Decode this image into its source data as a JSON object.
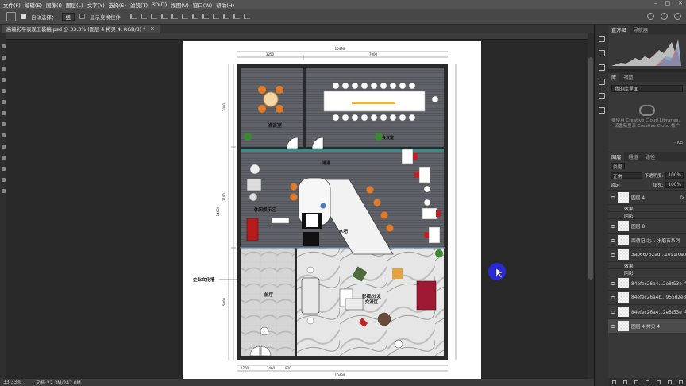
{
  "menubar": {
    "items": [
      "文件(F)",
      "编辑(E)",
      "图像(I)",
      "图层(L)",
      "文字(Y)",
      "选择(S)",
      "滤镜(T)",
      "3D(D)",
      "视图(V)",
      "窗口(W)",
      "帮助(H)"
    ]
  },
  "options": {
    "auto_select_label": "自动选择：",
    "auto_select_value": "组",
    "show_transform_label": "显示变换控件"
  },
  "document": {
    "tab_title": "高端彩平表现工装稿.psd @ 33.3% (图层 4 拷贝 4, RGB/8) *",
    "close_glyph": "×"
  },
  "status": {
    "zoom": "33.33%",
    "doc_size": "文档:22.3M/247.0M"
  },
  "plan": {
    "rooms": {
      "negotiation": "洽谈室",
      "meeting": "会议室",
      "corridor": "通道",
      "leisure": "休闲娱乐区",
      "bar": "水吧",
      "lobby": "前厅",
      "av_sofa_1": "影视/沙发",
      "av_sofa_2": "交流区",
      "culture_wall": "企业文化墙"
    },
    "dims_top": [
      "3250",
      "7000"
    ],
    "dims_top_total": "10490",
    "dims_left": [
      "2000",
      "3190",
      "5000"
    ],
    "dims_left_total": "14600",
    "dims_bottom": [
      "1460",
      "820"
    ],
    "dims_bottom_total": "10490",
    "dims_bottom_small": "1700"
  },
  "panels": {
    "tabs_top": [
      "直方图",
      "导航器"
    ],
    "tabs_mid": [
      "库",
      "调整"
    ],
    "library_select": "我的库里面",
    "cc_message": "要使用 Creative Cloud Libraries，请重新登录 Creative Cloud 帐户",
    "kb_label": "- KB",
    "tabs_layers": [
      "图层",
      "通道",
      "路径"
    ],
    "kind_filter": "类型",
    "blend_mode": "正常",
    "opacity_label": "不透明度:",
    "opacity_value": "100%",
    "lock_label": "锁定:",
    "fill_label": "填充:",
    "fill_value": "100%",
    "layers": [
      {
        "name": "图层 4",
        "fx": "fx",
        "selected": false
      },
      {
        "name": "效果",
        "sub": true
      },
      {
        "name": "阴影",
        "sub": true
      },
      {
        "name": "图层 8",
        "selected": false
      },
      {
        "name": "西德记 北... 水磨石系列",
        "selected": false
      },
      {
        "name": "3ab66732ad...1091fce0d",
        "fx": "fx",
        "selected": false
      },
      {
        "name": "效果",
        "sub": true
      },
      {
        "name": "阴影",
        "sub": true
      },
      {
        "name": "84efec26a4...2e8f53e 拷贝",
        "selected": false
      },
      {
        "name": "84efec26a4b...955d2e8f53e",
        "selected": false
      },
      {
        "name": "84efec26a4...2e8f53e 拷贝",
        "selected": false
      },
      {
        "name": "图层 4 拷贝 4",
        "selected": true
      }
    ]
  },
  "colors": {
    "cursor": "#2b2bd6",
    "wood": "#e07b2a",
    "accent_red": "#c41f24",
    "plant": "#3a8a2e"
  }
}
